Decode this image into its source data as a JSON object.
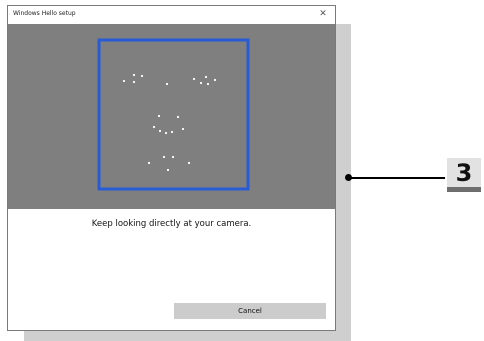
{
  "window": {
    "title": "Windows Hello setup",
    "close_glyph": "✕"
  },
  "camera": {
    "frame_color": "#2a5bd7",
    "background_color": "#7f7f7f",
    "face_point_color": "#ffffff"
  },
  "message": "Keep looking directly at your camera.",
  "buttons": {
    "cancel_label": "Cancel"
  },
  "callout": {
    "step_number": "3"
  }
}
